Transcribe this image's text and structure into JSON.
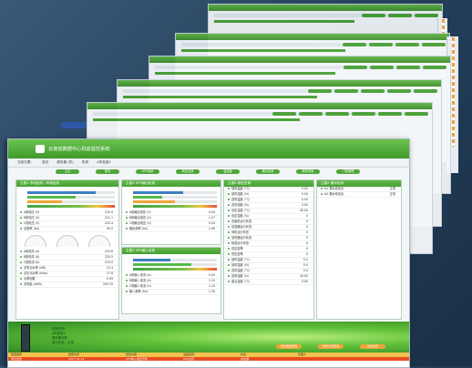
{
  "app": {
    "title": "云南省数据中心机房监控系统"
  },
  "nav": {
    "items": [
      "当前位置：",
      "首页",
      "|",
      "服务器 (机)",
      "|",
      "机房",
      "|",
      "A机柜室2"
    ]
  },
  "buttons": [
    "主页",
    "配电",
    "UPS系统",
    "精密空调",
    "温湿度",
    "漏水检测",
    "新风系统",
    "门禁管理"
  ],
  "panels": {
    "p1": {
      "title": "主路1 市电检测 - 环境信息",
      "bar_fills": [
        0.78,
        0.55,
        0.4
      ],
      "rows": [
        {
          "label": "A相电压 (V)",
          "value": "220.9"
        },
        {
          "label": "B相电压 (V)",
          "value": "221.1"
        },
        {
          "label": "C相电压 (V)",
          "value": "220.4"
        },
        {
          "label": "总频率 (Hz)",
          "value": "50.0"
        }
      ],
      "rows2": [
        {
          "label": "A相电流 (A)",
          "value": "223.6"
        },
        {
          "label": "B相电流 (A)",
          "value": "220.5"
        },
        {
          "label": "C相电流 (A)",
          "value": "223.5"
        },
        {
          "label": "总有功功率 (kW)",
          "value": "12.4"
        },
        {
          "label": "总无功功率 (kVar)",
          "value": "27.8"
        },
        {
          "label": "功率因数",
          "value": "0.99"
        },
        {
          "label": "总电能 (kWh)",
          "value": "205.25"
        }
      ]
    },
    "p2": {
      "title": "主路2 UPS输出信息",
      "bar_fills": [
        0.6,
        0.35,
        0.5
      ],
      "rows": [
        {
          "label": "A相输出电压 (V)",
          "value": "0.00"
        },
        {
          "label": "B相输出电压 (V)",
          "value": "1.37"
        },
        {
          "label": "C相输出电压 (V)",
          "value": "0.54"
        },
        {
          "label": "输出频率 (Hz)",
          "value": "1.96"
        }
      ]
    },
    "p3": {
      "title": "主路3 UPS输入信息",
      "bar_fills": [
        0.45,
        0.7
      ],
      "rows": [
        {
          "label": "A相输入电流 (A)",
          "value": "0.00"
        },
        {
          "label": "B相输入电流 (A)",
          "value": "1.20"
        },
        {
          "label": "C相输入电流 (A)",
          "value": "1.20"
        },
        {
          "label": "输入频率 (Hz)",
          "value": "1.30"
        }
      ]
    },
    "p4": {
      "title": "主路4 精密空调",
      "rows": [
        {
          "label": "回风温度 (°C)",
          "value": "0.00"
        },
        {
          "label": "回风湿度 (%)",
          "value": "0.00"
        },
        {
          "label": "送风温度 (°C)",
          "value": "0.00"
        },
        {
          "label": "送风湿度 (%)",
          "value": "0.00"
        },
        {
          "label": "设定温度 (°C)",
          "value": "45.00"
        },
        {
          "label": "设定湿度 (%)",
          "value": "0"
        },
        {
          "label": "压缩机运行状态",
          "value": "0"
        },
        {
          "label": "加湿器运行状态",
          "value": "0"
        },
        {
          "label": "风机运行状态",
          "value": "0"
        },
        {
          "label": "加热器运行状态",
          "value": "0"
        },
        {
          "label": "除湿运行状态",
          "value": "0"
        },
        {
          "label": "高压告警",
          "value": "0"
        },
        {
          "label": "低压告警",
          "value": "0"
        },
        {
          "label": "回风温度 (°C)",
          "value": "0.0"
        },
        {
          "label": "回风湿度 (%)",
          "value": "0.0"
        },
        {
          "label": "送风温度 (°C)",
          "value": "0.0"
        },
        {
          "label": "送风湿度 (%)",
          "value": "45.00"
        },
        {
          "label": "露点温度 (°C)",
          "value": "0.00"
        }
      ]
    },
    "p5": {
      "title": "主路5 漏水检测",
      "rows": [
        {
          "label": "A1 漏水检测点",
          "value": "正常"
        },
        {
          "label": "A2 漏水检测点",
          "value": "正常"
        }
      ]
    }
  },
  "banner": {
    "lines": [
      "机房名称：",
      "A机柜室2",
      "服务器总数：",
      "运行状态：正常"
    ],
    "buttons": [
      "历史数据查询",
      "告警记录查询",
      "系统设置"
    ]
  },
  "alarm": {
    "headers": [
      "告警级别",
      "告警时间",
      "告警内容",
      "设备名称",
      "状态",
      "处理人"
    ],
    "rows": [
      [
        "紧急告警",
        "2017-01-12",
        "UPS输入电压异常",
        "UPS主机",
        "未处理",
        ""
      ]
    ]
  }
}
